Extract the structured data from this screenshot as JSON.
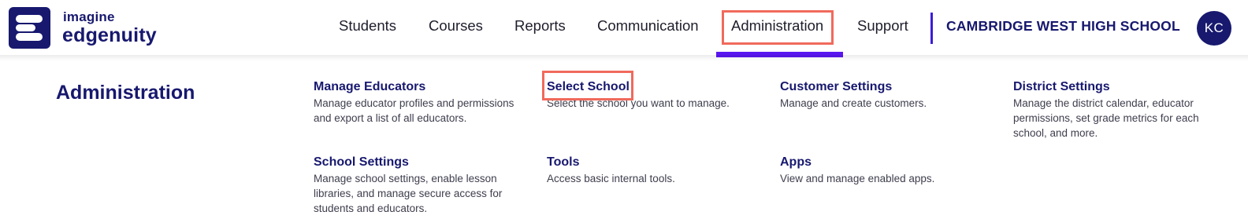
{
  "brand": {
    "line1": "imagine",
    "line2": "edgenuity",
    "color": "#17186e"
  },
  "nav": {
    "items": [
      {
        "label": "Students"
      },
      {
        "label": "Courses"
      },
      {
        "label": "Reports"
      },
      {
        "label": "Communication"
      },
      {
        "label": "Administration",
        "active": true
      },
      {
        "label": "Support"
      }
    ],
    "active_color": "#5a16f0",
    "highlight_color": "#f06a5c"
  },
  "school": {
    "name": "CAMBRIDGE WEST HIGH SCHOOL"
  },
  "user": {
    "initials": "KC"
  },
  "menu": {
    "section_title": "Administration",
    "items": [
      {
        "title": "Manage Educators",
        "description": "Manage educator profiles and permissions and export a list of all educators."
      },
      {
        "title": "Select School",
        "description": "Select the school you want to manage."
      },
      {
        "title": "Customer Settings",
        "description": "Manage and create customers."
      },
      {
        "title": "District Settings",
        "description": "Manage the district calendar, educator permissions, set grade metrics for each school, and more."
      },
      {
        "title": "School Settings",
        "description": "Manage school settings, enable lesson libraries, and manage secure access for students and educators."
      },
      {
        "title": "Tools",
        "description": "Access basic internal tools."
      },
      {
        "title": "Apps",
        "description": "View and manage enabled apps."
      }
    ]
  }
}
